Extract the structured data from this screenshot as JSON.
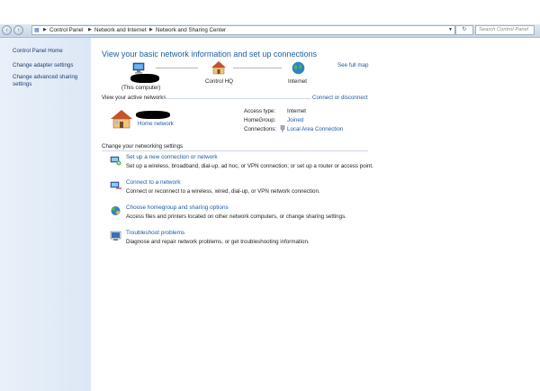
{
  "address_bar": {
    "breadcrumbs": [
      "Control Panel",
      "Network and Internet",
      "Network and Sharing Center"
    ],
    "search_placeholder": "Search Control Panel"
  },
  "sidebar": {
    "items": [
      {
        "label": "Control Panel Home"
      },
      {
        "label": "Change adapter settings"
      },
      {
        "label": "Change advanced sharing settings"
      }
    ]
  },
  "main": {
    "title": "View your basic network information and set up connections",
    "see_full_map": "See full map",
    "map": {
      "computer_label": "(This computer)",
      "network_label": "Control HQ",
      "internet_label": "Internet"
    },
    "active_networks": {
      "header": "View your active networks",
      "connect_link": "Connect or disconnect",
      "network_type": "Home network",
      "access_type_label": "Access type:",
      "access_type_value": "Internet",
      "homegroup_label": "HomeGroup:",
      "homegroup_value": "Joined",
      "connections_label": "Connections:",
      "connections_value": "Local Area Connection"
    },
    "settings": {
      "header": "Change your networking settings",
      "tasks": [
        {
          "title": "Set up a new connection or network",
          "desc": "Set up a wireless, broadband, dial-up, ad hoc, or VPN connection; or set up a router or access point.",
          "icon": "new-connection-icon"
        },
        {
          "title": "Connect to a network",
          "desc": "Connect or reconnect to a wireless, wired, dial-up, or VPN network connection.",
          "icon": "connect-network-icon"
        },
        {
          "title": "Choose homegroup and sharing options",
          "desc": "Access files and printers located on other network computers, or change sharing settings.",
          "icon": "homegroup-icon"
        },
        {
          "title": "Troubleshoot problems",
          "desc": "Diagnose and repair network problems, or get troubleshooting information.",
          "icon": "troubleshoot-icon"
        }
      ]
    }
  },
  "colors": {
    "link": "#1c5aa6",
    "heading": "#1f5fa0",
    "sidebar_bg": "#e3ebf6",
    "addressbar_bg": "#d5e0ee"
  }
}
